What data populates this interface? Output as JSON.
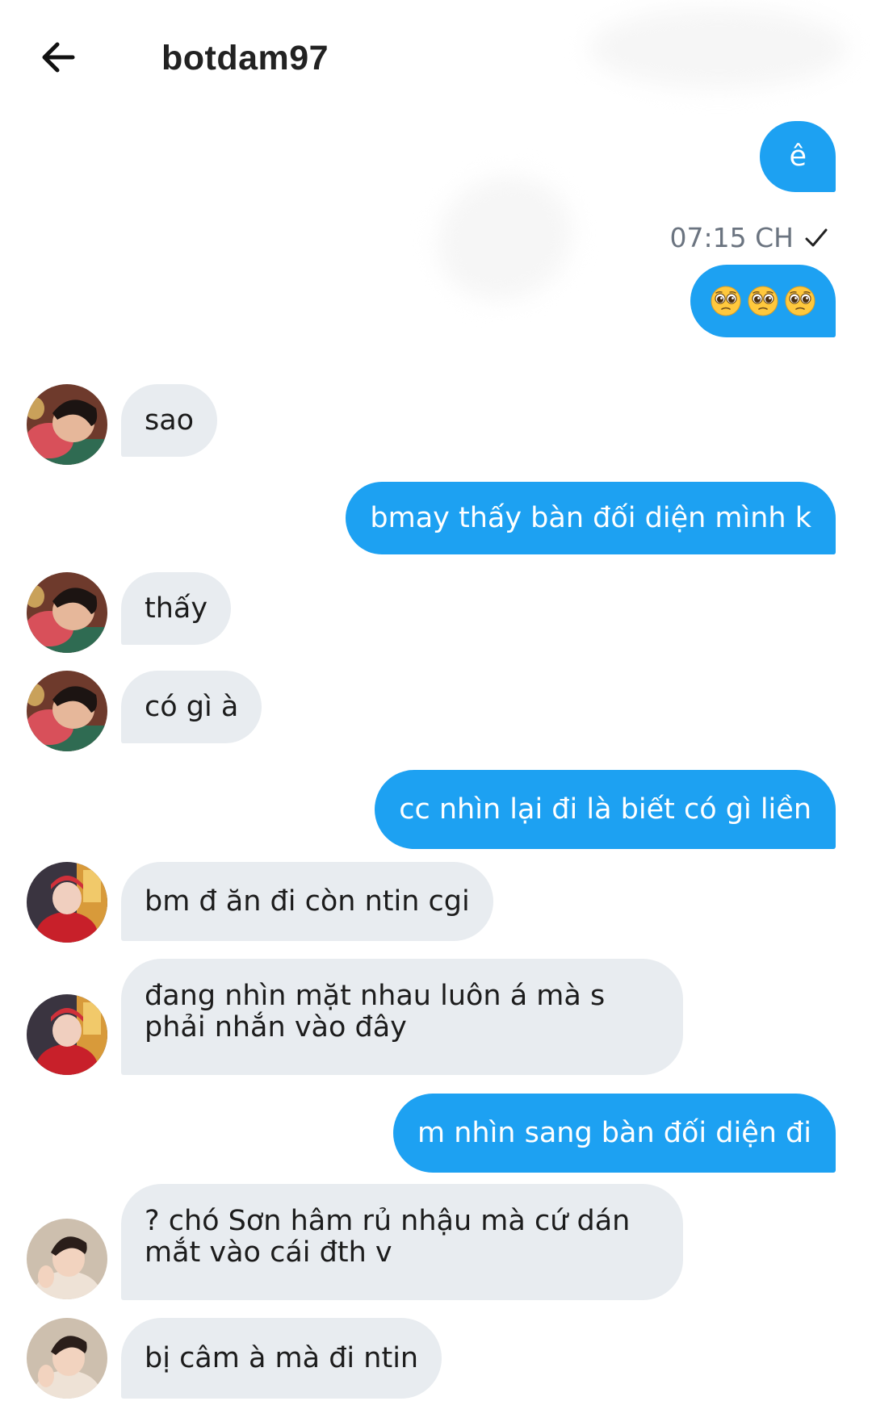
{
  "header": {
    "title": "botdam97",
    "back_icon": "arrow-left-icon"
  },
  "colors": {
    "outgoing_bubble": "#1da1f2",
    "incoming_bubble": "#e8ecf0",
    "timestamp_text": "#6b7480"
  },
  "messages": [
    {
      "dir": "out",
      "text": "ê"
    },
    {
      "dir": "meta",
      "timestamp": "07:15 CH",
      "status_icon": "checkmark-icon"
    },
    {
      "dir": "out",
      "emoji": [
        "pleading-face-icon",
        "pleading-face-icon",
        "pleading-face-icon"
      ]
    },
    {
      "dir": "in",
      "avatar": "avatar-user-a",
      "text": "sao"
    },
    {
      "dir": "out",
      "text": "bmay thấy bàn đối diện mình k"
    },
    {
      "dir": "in",
      "avatar": "avatar-user-a",
      "text": "thấy"
    },
    {
      "dir": "in",
      "avatar": "avatar-user-a",
      "text": "có gì à"
    },
    {
      "dir": "out",
      "text": "cc nhìn lại đi là biết có gì liền"
    },
    {
      "dir": "in",
      "avatar": "avatar-user-b",
      "text": "bm đ ăn đi còn ntin cgi"
    },
    {
      "dir": "in",
      "avatar": "avatar-user-b",
      "text": "đang nhìn mặt nhau luôn á mà s phải nhắn vào đây"
    },
    {
      "dir": "out",
      "text": "m nhìn sang bàn đối diện đi"
    },
    {
      "dir": "in",
      "avatar": "avatar-user-c",
      "text": "? chó Sơn hâm rủ nhậu mà cứ dán mắt vào cái đth v"
    },
    {
      "dir": "in",
      "avatar": "avatar-user-c",
      "text": "bị câm à mà đi ntin"
    }
  ]
}
